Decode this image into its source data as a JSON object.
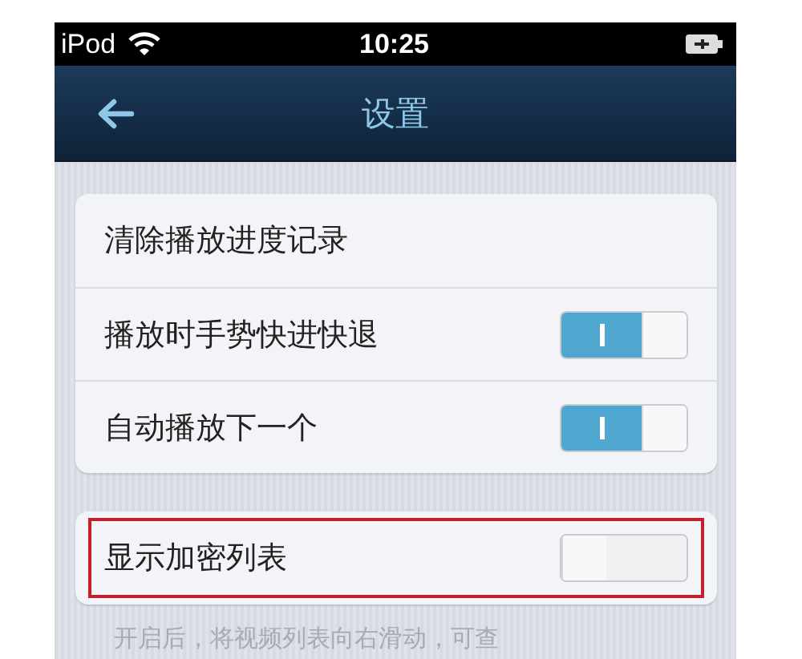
{
  "status_bar": {
    "carrier": "iPod",
    "time": "10:25"
  },
  "nav_bar": {
    "title": "设置"
  },
  "groups": [
    {
      "items": [
        {
          "kind": "action",
          "label": "清除播放进度记录",
          "highlighted": false
        },
        {
          "kind": "toggle",
          "label": "播放时手势快进快退",
          "on": true,
          "highlighted": false
        },
        {
          "kind": "toggle",
          "label": "自动播放下一个",
          "on": true,
          "highlighted": false
        }
      ]
    },
    {
      "items": [
        {
          "kind": "toggle",
          "label": "显示加密列表",
          "on": false,
          "highlighted": true
        }
      ],
      "footer": "开启后，将视频列表向右滑动，可查"
    }
  ]
}
